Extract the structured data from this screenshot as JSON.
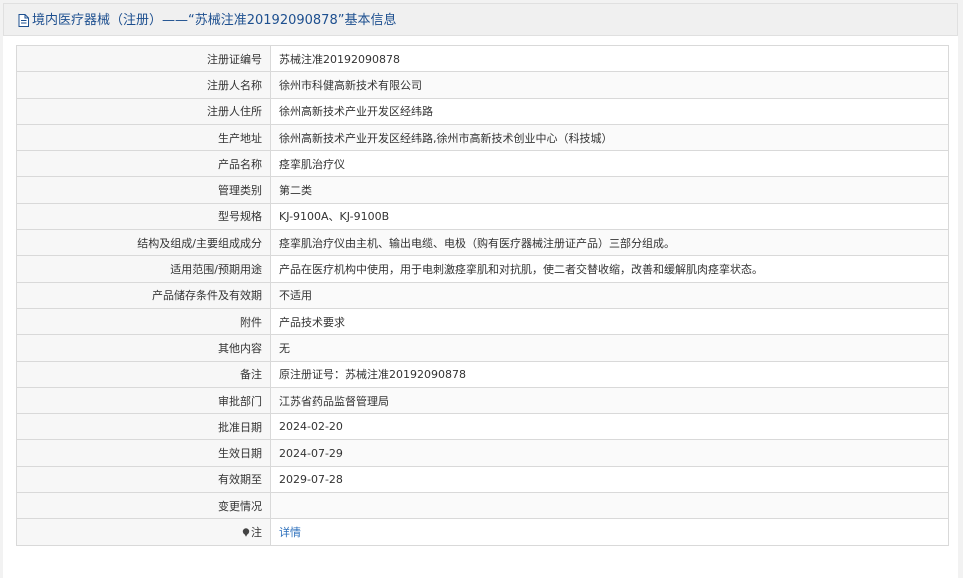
{
  "header": {
    "title": "境内医疗器械（注册）——“苏械注准20192090878”基本信息",
    "icon": "document-icon"
  },
  "rows": [
    {
      "label": "注册证编号",
      "value": "苏械注准20192090878"
    },
    {
      "label": "注册人名称",
      "value": "徐州市科健高新技术有限公司"
    },
    {
      "label": "注册人住所",
      "value": "徐州高新技术产业开发区经纬路"
    },
    {
      "label": "生产地址",
      "value": "徐州高新技术产业开发区经纬路,徐州市高新技术创业中心（科技城）"
    },
    {
      "label": "产品名称",
      "value": "痉挛肌治疗仪"
    },
    {
      "label": "管理类别",
      "value": "第二类"
    },
    {
      "label": "型号规格",
      "value": "KJ-9100A、KJ-9100B"
    },
    {
      "label": "结构及组成/主要组成成分",
      "value": "痉挛肌治疗仪由主机、输出电缆、电极（购有医疗器械注册证产品）三部分组成。"
    },
    {
      "label": "适用范围/预期用途",
      "value": "产品在医疗机构中使用，用于电刺激痉挛肌和对抗肌，使二者交替收缩，改善和缓解肌肉痉挛状态。"
    },
    {
      "label": "产品储存条件及有效期",
      "value": "不适用"
    },
    {
      "label": "附件",
      "value": "产品技术要求"
    },
    {
      "label": "其他内容",
      "value": "无"
    },
    {
      "label": "备注",
      "value": "原注册证号：苏械注准20192090878"
    },
    {
      "label": "审批部门",
      "value": "江苏省药品监督管理局"
    },
    {
      "label": "批准日期",
      "value": "2024-02-20"
    },
    {
      "label": "生效日期",
      "value": "2024-07-29"
    },
    {
      "label": "有效期至",
      "value": "2029-07-28"
    },
    {
      "label": "变更情况",
      "value": ""
    }
  ],
  "note": {
    "label": "注",
    "icon": "pin-icon",
    "link_text": "详情"
  },
  "colors": {
    "title_blue": "#1d4f8f",
    "link_blue": "#2a6ebb",
    "border": "#d9d9d9"
  }
}
